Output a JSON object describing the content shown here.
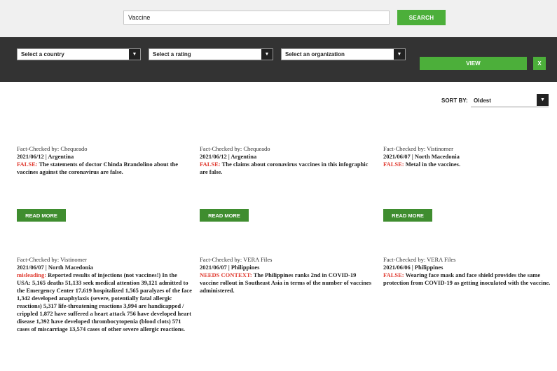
{
  "search": {
    "value": "Vaccine",
    "button_label": "SEARCH"
  },
  "filters": {
    "country": "Select a country",
    "rating": "Select a rating",
    "organization": "Select an organization",
    "view_label": "VIEW",
    "clear_label": "X"
  },
  "sort": {
    "label": "SORT BY:",
    "value": "Oldest"
  },
  "read_more_label": "READ MORE",
  "cards": [
    {
      "checker": "Fact-Checked by: Chequeado",
      "date_country": "2021/06/12 | Argentina",
      "rating": "FALSE:",
      "claim": "The statements of doctor Chinda Brandolino about the vaccines against the coronavirus are false."
    },
    {
      "checker": "Fact-Checked by: Chequeado",
      "date_country": "2021/06/12 | Argentina",
      "rating": "FALSE:",
      "claim": "The claims about coronavirus vaccines in this infographic are false."
    },
    {
      "checker": "Fact-Checked by: Vistinomer",
      "date_country": "2021/06/07 | North Macedonia",
      "rating": "FALSE:",
      "claim": "Metal in the vaccines."
    },
    {
      "checker": "Fact-Checked by: Vistinomer",
      "date_country": "2021/06/07 | North Macedonia",
      "rating": "misleading:",
      "claim": "Reported results of injections (not vaccines!) In the USA: 5,165 deaths 51,133 seek medical attention 39,121 admitted to the Emergency Center 17,619 hospitalized 1,565 paralyzes of the face 1,342 developed anaphylaxis (severe, potentially fatal allergic reactions) 5,317 life-threatening reactions 3,994 are handicapped / crippled 1,872 have suffered a heart attack 756 have developed heart disease 1,392 have developed thrombocytopenia (blood clots) 571 cases of miscarriage 13,574 cases of other severe allergic reactions."
    },
    {
      "checker": "Fact-Checked by: VERA Files",
      "date_country": "2021/06/07 | Philippines",
      "rating": "NEEDS CONTEXT:",
      "claim": "The Philippines ranks 2nd in COVID-19 vaccine rollout in Southeast Asia in terms of the number of vaccines administered."
    },
    {
      "checker": "Fact-Checked by: VERA Files",
      "date_country": "2021/06/06 | Philippines",
      "rating": "FALSE:",
      "claim": "Wearing face mask and face shield provides the same protection from COVID-19 as getting inoculated with the vaccine."
    }
  ],
  "colors": {
    "accent_green": "#4caf3a",
    "dark_green": "#3f8d2f",
    "rating_red": "#e03a2f",
    "filter_bg": "#333333"
  }
}
